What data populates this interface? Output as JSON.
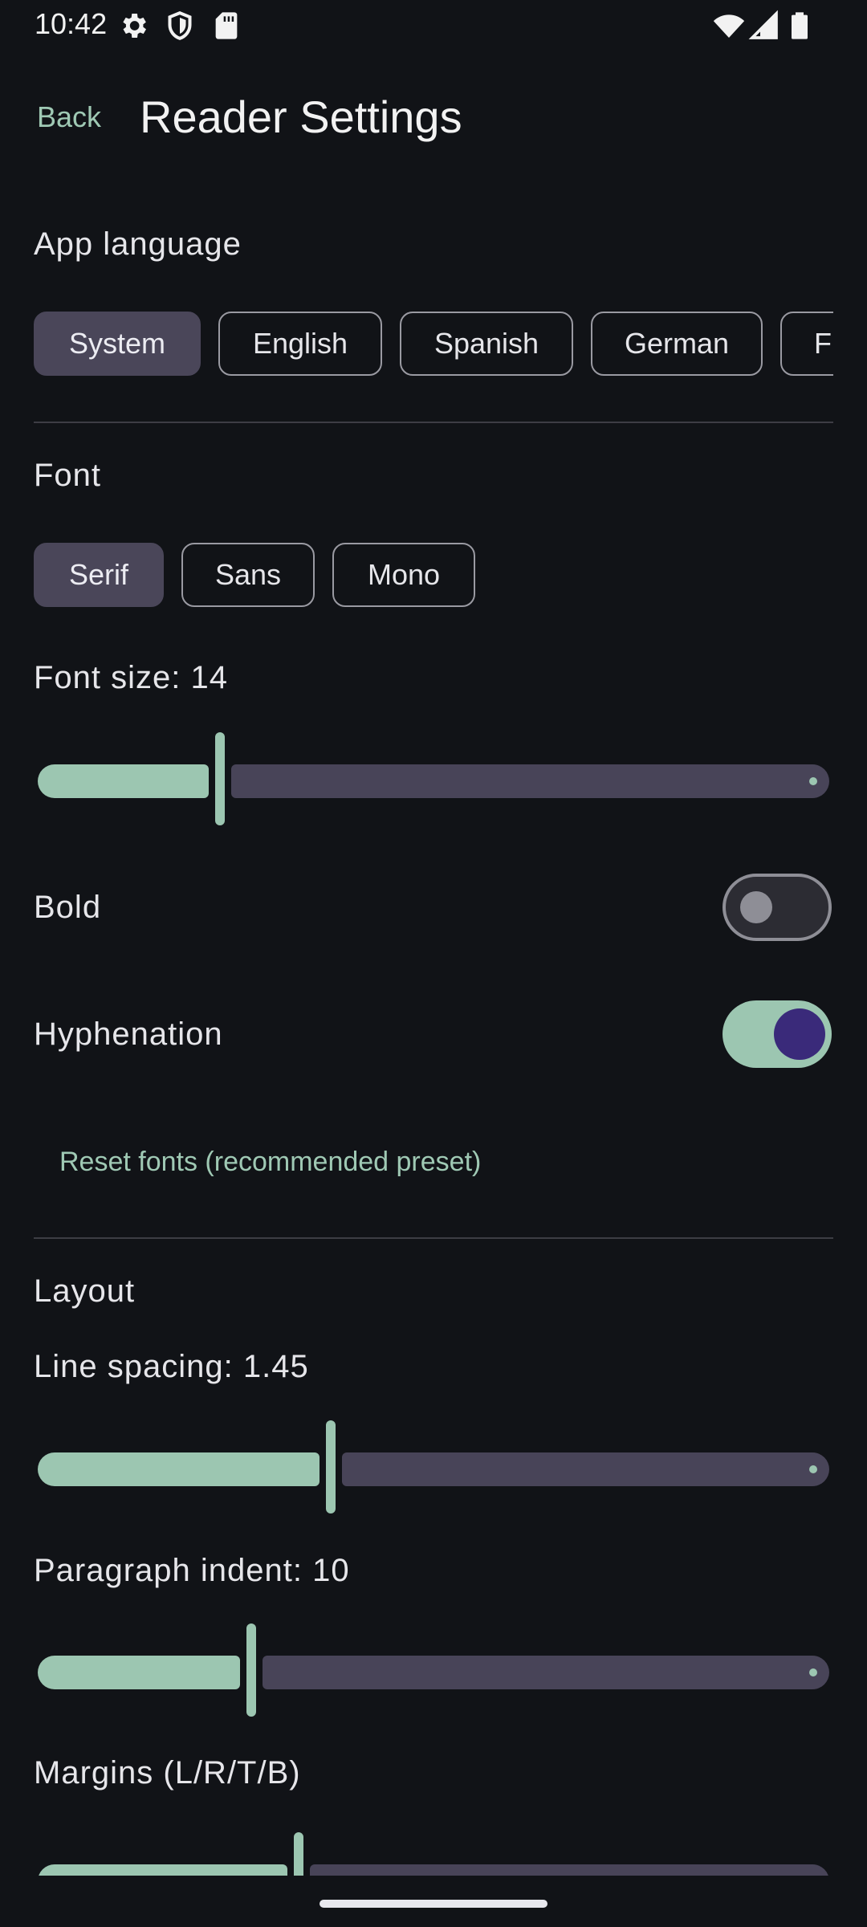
{
  "status": {
    "time": "10:42"
  },
  "header": {
    "back_label": "Back",
    "title": "Reader Settings"
  },
  "language": {
    "label": "App language",
    "options": [
      "System",
      "English",
      "Spanish",
      "German",
      "French"
    ],
    "selected": "System"
  },
  "font": {
    "label": "Font",
    "options": [
      "Serif",
      "Sans",
      "Mono"
    ],
    "selected": "Serif",
    "size_label": "Font size: 14",
    "size_value": 14
  },
  "bold": {
    "label": "Bold",
    "on": false
  },
  "hyphenation": {
    "label": "Hyphenation",
    "on": true
  },
  "reset_label": "Reset fonts (recommended preset)",
  "layout": {
    "label": "Layout",
    "line_spacing_label": "Line spacing: 1.45",
    "line_spacing_value": 1.45,
    "paragraph_indent_label": "Paragraph indent: 10",
    "paragraph_indent_value": 10,
    "margins_label": "Margins (L/R/T/B)"
  },
  "slider_fractions": {
    "font_size": 0.23,
    "line_spacing": 0.37,
    "paragraph_indent": 0.27,
    "margins": 0.33
  },
  "colors": {
    "accent": "#9cc6b1",
    "selected_chip": "#4a4659",
    "background": "#111317",
    "switch_knob_on": "#3a2a7a"
  }
}
